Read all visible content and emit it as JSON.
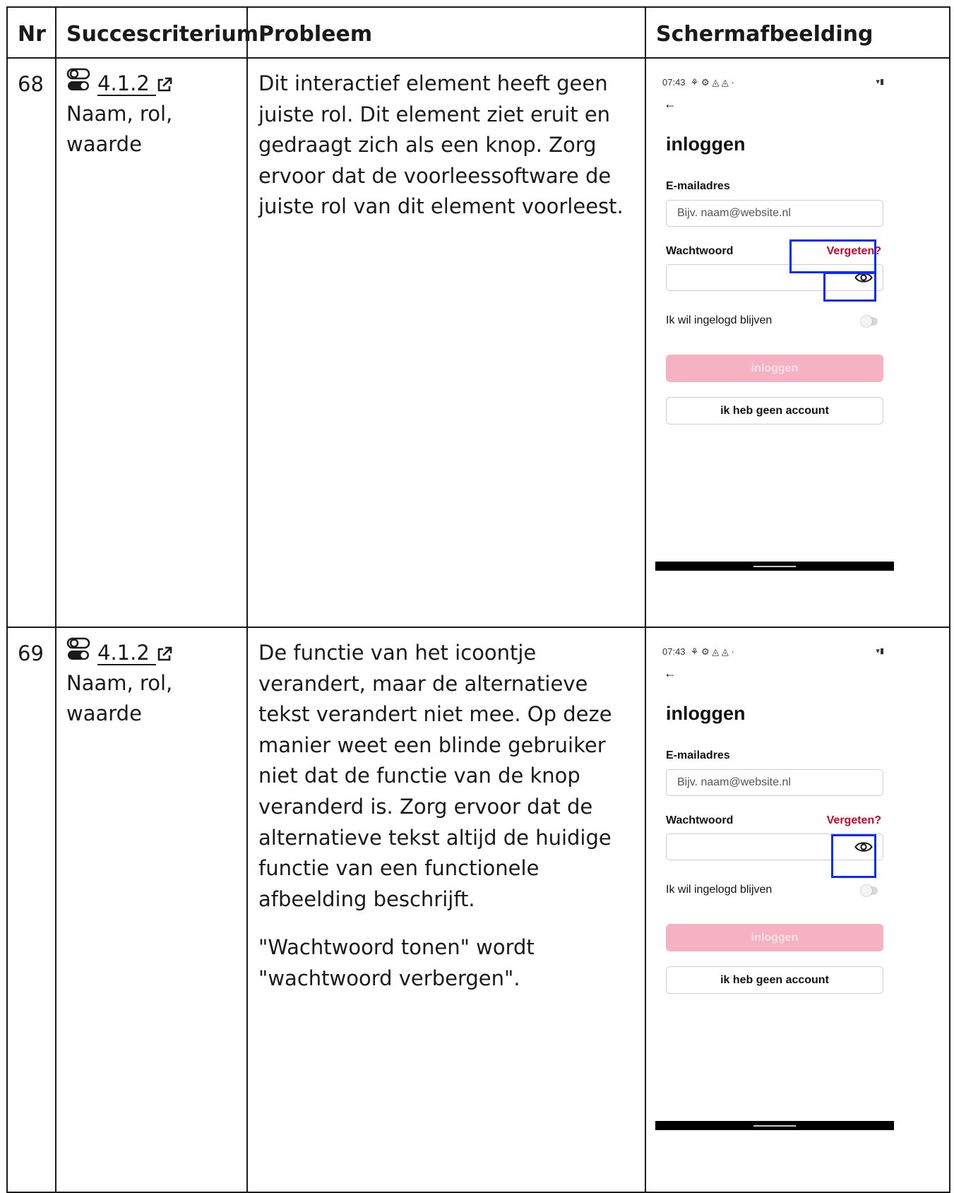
{
  "headers": {
    "nr": "Nr",
    "criterion": "Succescriterium",
    "problem": "Probleem",
    "screenshot": "Schermafbeelding"
  },
  "rows": [
    {
      "nr": "68",
      "criterion_code": "4.1.2",
      "criterion_name": "Naam, rol, waarde",
      "problem": [
        "Dit interactief element heeft geen juiste rol. Dit element ziet eruit en gedraagt zich als een knop. Zorg ervoor dat de voorleessoftware de juiste rol van dit element voorleest."
      ]
    },
    {
      "nr": "69",
      "criterion_code": "4.1.2",
      "criterion_name": "Naam, rol, waarde",
      "problem": [
        "De functie van het icoontje verandert, maar de alternatieve tekst verandert niet mee. Op deze manier weet een blinde gebruiker niet dat de functie van de knop veranderd is. Zorg ervoor dat de alternatieve tekst altijd de huidige functie van een functionele afbeelding beschrijft.",
        "\"Wachtwoord tonen\" wordt \"wachtwoord verbergen\"."
      ]
    }
  ],
  "phone": {
    "time": "07:43",
    "status_icons": "⚘ ⚙ ◬ ◬ ·",
    "status_right": "▾▮",
    "back": "←",
    "title": "inloggen",
    "email_label": "E-mailadres",
    "email_placeholder": "Bijv. naam@website.nl",
    "password_label": "Wachtwoord",
    "forgot": "Vergeten?",
    "stay_logged_in": "Ik wil ingelogd blijven",
    "login_button": "inloggen",
    "no_account_button": "ik heb geen account"
  },
  "colors": {
    "highlight": "#0a2cff",
    "forgot": "#d2002b",
    "login_disabled_bg": "#f6b1c2"
  },
  "icons": [
    "toggle-icon",
    "external-link-icon",
    "eye-icon",
    "back-arrow-icon"
  ]
}
